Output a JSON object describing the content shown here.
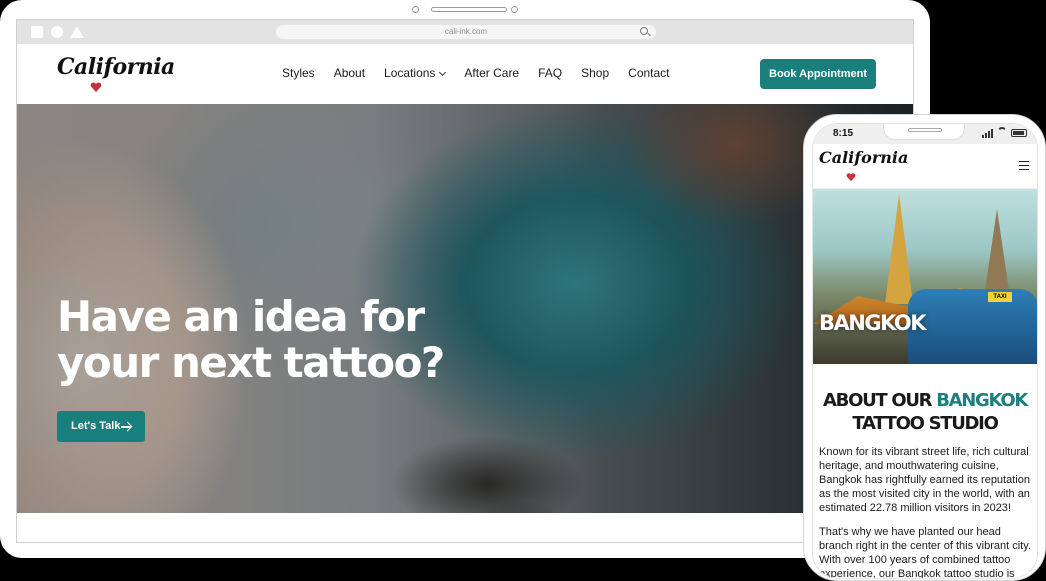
{
  "desktop": {
    "url": "cali-ink.com",
    "logo_text": "California",
    "nav": [
      "Styles",
      "About",
      "Locations",
      "After Care",
      "FAQ",
      "Shop",
      "Contact"
    ],
    "book_button": "Book Appointment",
    "hero": {
      "title": "Have an idea for your next tattoo?",
      "cta": "Let's Talk"
    }
  },
  "mobile": {
    "time": "8:15",
    "logo_text": "California",
    "hero_title": "BANGKOK",
    "taxi_sign": "TAXI",
    "about_title": {
      "line1_prefix": "ABOUT OUR",
      "line1_accent": "BANGKOK",
      "line2": "TATTOO STUDIO"
    },
    "paragraph1": "Known for its vibrant street life, rich cultural heritage, and mouthwatering cuisine, Bangkok has rightfully earned its reputation as the most visited city in the world, with an estimated 22.78 million visitors in 2023!",
    "paragraph2": "That's why we have planted our head branch right in the center of this vibrant city. With over 100 years of combined tattoo experience, our Bangkok tattoo studio is sure"
  },
  "colors": {
    "accent": "#197f7c",
    "heart": "#c8323c"
  }
}
